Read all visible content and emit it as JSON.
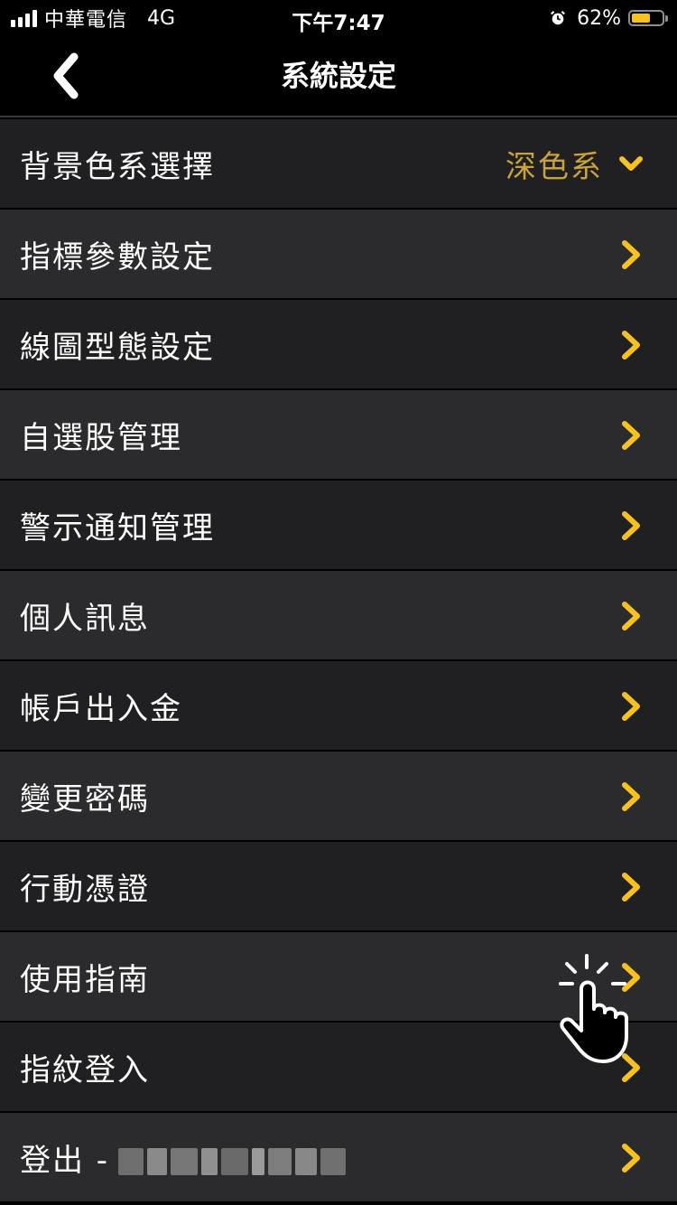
{
  "status_bar": {
    "carrier": "中華電信",
    "network": "4G",
    "time": "下午7:47",
    "battery_percent": "62%",
    "battery_level": 0.62,
    "icons": [
      "signal-icon",
      "alarm-icon",
      "battery-icon"
    ]
  },
  "nav": {
    "title": "系統設定",
    "back_icon": "chevron-left-icon"
  },
  "menu": {
    "items": [
      {
        "label": "背景色系選擇",
        "value": "深色系",
        "icon": "chevron-down-icon"
      },
      {
        "label": "指標參數設定",
        "icon": "chevron-right-icon"
      },
      {
        "label": "線圖型態設定",
        "icon": "chevron-right-icon"
      },
      {
        "label": "自選股管理",
        "icon": "chevron-right-icon"
      },
      {
        "label": "警示通知管理",
        "icon": "chevron-right-icon"
      },
      {
        "label": "個人訊息",
        "icon": "chevron-right-icon"
      },
      {
        "label": "帳戶出入金",
        "icon": "chevron-right-icon"
      },
      {
        "label": "變更密碼",
        "icon": "chevron-right-icon"
      },
      {
        "label": "行動憑證",
        "icon": "chevron-right-icon"
      },
      {
        "label": "使用指南",
        "icon": "chevron-right-icon"
      },
      {
        "label": "指紋登入",
        "icon": "chevron-right-icon"
      },
      {
        "label": "登出 -",
        "icon": "chevron-right-icon"
      }
    ]
  },
  "colors": {
    "accent": "#f6c21b",
    "value_text": "#c9a33a",
    "row_dark": "#202022",
    "row_light": "#2b2b2e",
    "background": "#000000"
  }
}
